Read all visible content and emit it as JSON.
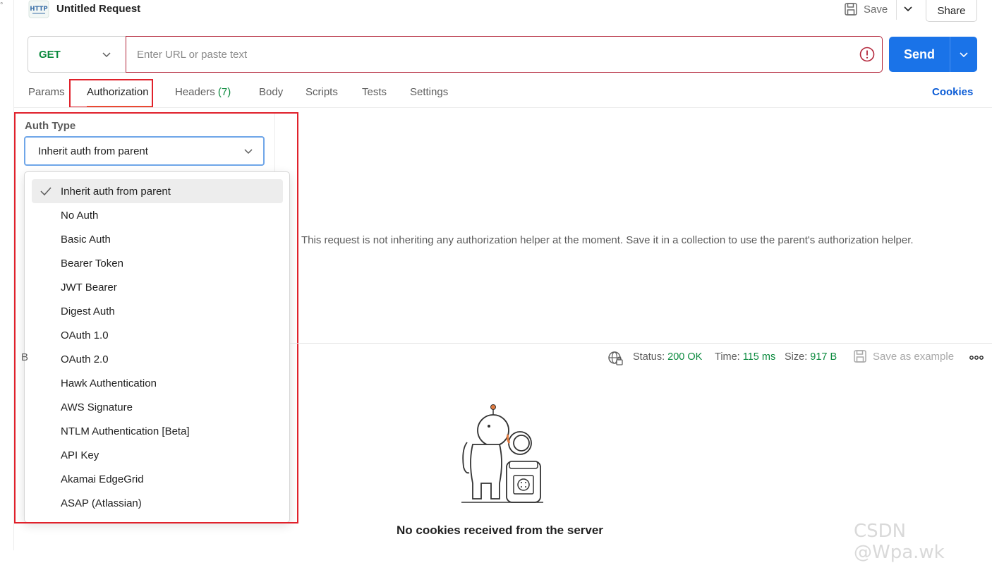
{
  "header": {
    "title": "Untitled Request",
    "save_label": "Save",
    "share_label": "Share",
    "http_icon_text": "HTTP"
  },
  "gutter": {
    "mark": "°"
  },
  "url_bar": {
    "method": "GET",
    "url_value": "",
    "url_placeholder": "Enter URL or paste text",
    "send_label": "Send"
  },
  "tabs": {
    "params": "Params",
    "authorization": "Authorization",
    "headers": "Headers",
    "headers_count": "(7)",
    "body": "Body",
    "scripts": "Scripts",
    "tests": "Tests",
    "settings": "Settings",
    "cookies": "Cookies"
  },
  "auth": {
    "type_label": "Auth Type",
    "selected": "Inherit auth from parent",
    "info": "This request is not inheriting any authorization helper at the moment. Save it in a collection to use the parent's authorization helper.",
    "options": [
      "Inherit auth from parent",
      "No Auth",
      "Basic Auth",
      "Bearer Token",
      "JWT Bearer",
      "Digest Auth",
      "OAuth 1.0",
      "OAuth 2.0",
      "Hawk Authentication",
      "AWS Signature",
      "NTLM Authentication [Beta]",
      "API Key",
      "Akamai EdgeGrid",
      "ASAP (Atlassian)"
    ]
  },
  "response": {
    "partial_label": "B",
    "status_label": "Status:",
    "status_value": "200 OK",
    "time_label": "Time:",
    "time_value": "115 ms",
    "size_label": "Size:",
    "size_value": "917 B",
    "save_example": "Save as example",
    "empty_message": "No cookies received from the server"
  },
  "watermark": "CSDN @Wpa.wk",
  "colors": {
    "accent_blue": "#1a73e8",
    "method_green": "#0b8a3e",
    "highlight_red": "#e0212b",
    "active_tab_underline": "#f26b3a"
  }
}
